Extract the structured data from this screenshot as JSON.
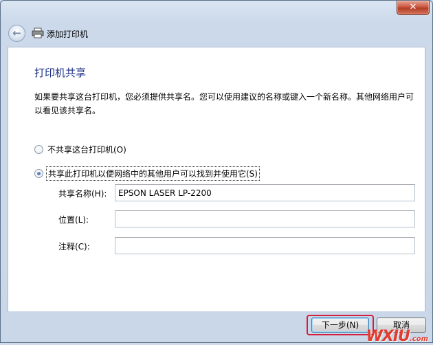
{
  "window": {
    "title": "添加打印机",
    "close_label": "✕"
  },
  "page": {
    "heading": "打印机共享",
    "description": "如果要共享这台打印机，您必须提供共享名。您可以使用建议的名称或键入一个新名称。其他网络用户可以看见该共享名。"
  },
  "options": {
    "no_share_label": "不共享这台打印机(O)",
    "share_label": "共享此打印机以便网络中的其他用户可以找到并使用它(S)",
    "selected": "share"
  },
  "fields": {
    "share_name_label": "共享名称(H):",
    "share_name_value": "EPSON LASER LP-2200",
    "location_label": "位置(L):",
    "location_value": "",
    "comment_label": "注释(C):",
    "comment_value": ""
  },
  "buttons": {
    "next_label": "下一步(N)",
    "cancel_label": "取消"
  },
  "watermark": {
    "brand": "WXIU",
    "suffix": ".com"
  },
  "colors": {
    "heading": "#1e3287",
    "highlight": "#d61f3e"
  }
}
